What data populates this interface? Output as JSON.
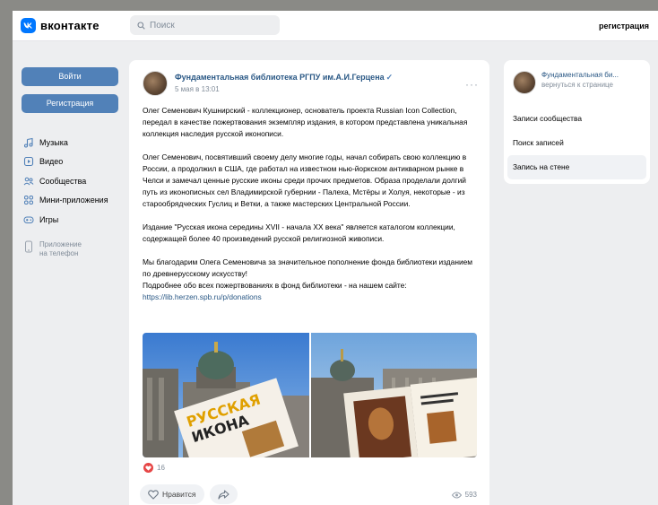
{
  "header": {
    "logo_text": "вконтакте",
    "logo_mark": "vk-logo-icon",
    "search_placeholder": "Поиск",
    "register_link": "регистрация"
  },
  "left": {
    "login_button": "Войти",
    "register_button": "Регистрация",
    "nav": [
      {
        "label": "Музыка",
        "icon": "music-icon"
      },
      {
        "label": "Видео",
        "icon": "video-icon"
      },
      {
        "label": "Сообщества",
        "icon": "communities-icon"
      },
      {
        "label": "Мини-приложения",
        "icon": "mini-apps-icon"
      },
      {
        "label": "Игры",
        "icon": "games-icon"
      }
    ],
    "app_line1": "Приложение",
    "app_line2": "на телефон"
  },
  "post": {
    "author": "Фундаментальная библиотека РГПУ им.А.И.Герцена",
    "verified_glyph": "✓",
    "date": "5 мая в 13:01",
    "more_glyph": "···",
    "paragraphs": [
      "Олег Семенович Кушнирский - коллекционер, основатель проекта Russian Icon Collection, передал в качестве пожертвования экземпляр издания, в котором представлена уникальная коллекция наследия русской иконописи.",
      "Олег Семенович, посвятивший своему делу многие годы, начал собирать свою коллекцию в России, а продолжил в США, где работал на известном нью-йоркском антикварном рынке в Челси и замечал ценные русские иконы среди прочих предметов. Образа проделали долгий путь из иконописных сел Владимирской губернии - Палеха, Мстёры и Холуя, некоторые - из старообрядческих Гуслиц и Ветки, а также мастерских Центральной России.",
      "Издание \"Русская икона середины XVII - начала XX века\" является каталогом коллекции, содержащей более 40 произведений русской религиозной живописи."
    ],
    "last_p_line1": "Мы благодарим Олега Семеновича за значительное пополнение фонда библиотеки изданием по древнерусскому искусству!",
    "last_p_line2": "Подробнее обо всех пожертвованиях в фонд библиотеки - на нашем сайте:",
    "link": "https://lib.herzen.spb.ru/p/donations",
    "photo_book_text_1": "РУССКАЯ",
    "photo_book_text_2": "ИКОНА",
    "likes_count": "16",
    "like_button": "Нравится",
    "views_count": "593",
    "colors": {
      "like": "#e64646",
      "link": "#2a5885",
      "button": "#5181b8"
    }
  },
  "right": {
    "group_name": "Фундаментальная би...",
    "back_link": "вернуться к странице",
    "menu": [
      "Записи сообщества",
      "Поиск записей",
      "Запись на стене"
    ],
    "active_index": 2
  }
}
